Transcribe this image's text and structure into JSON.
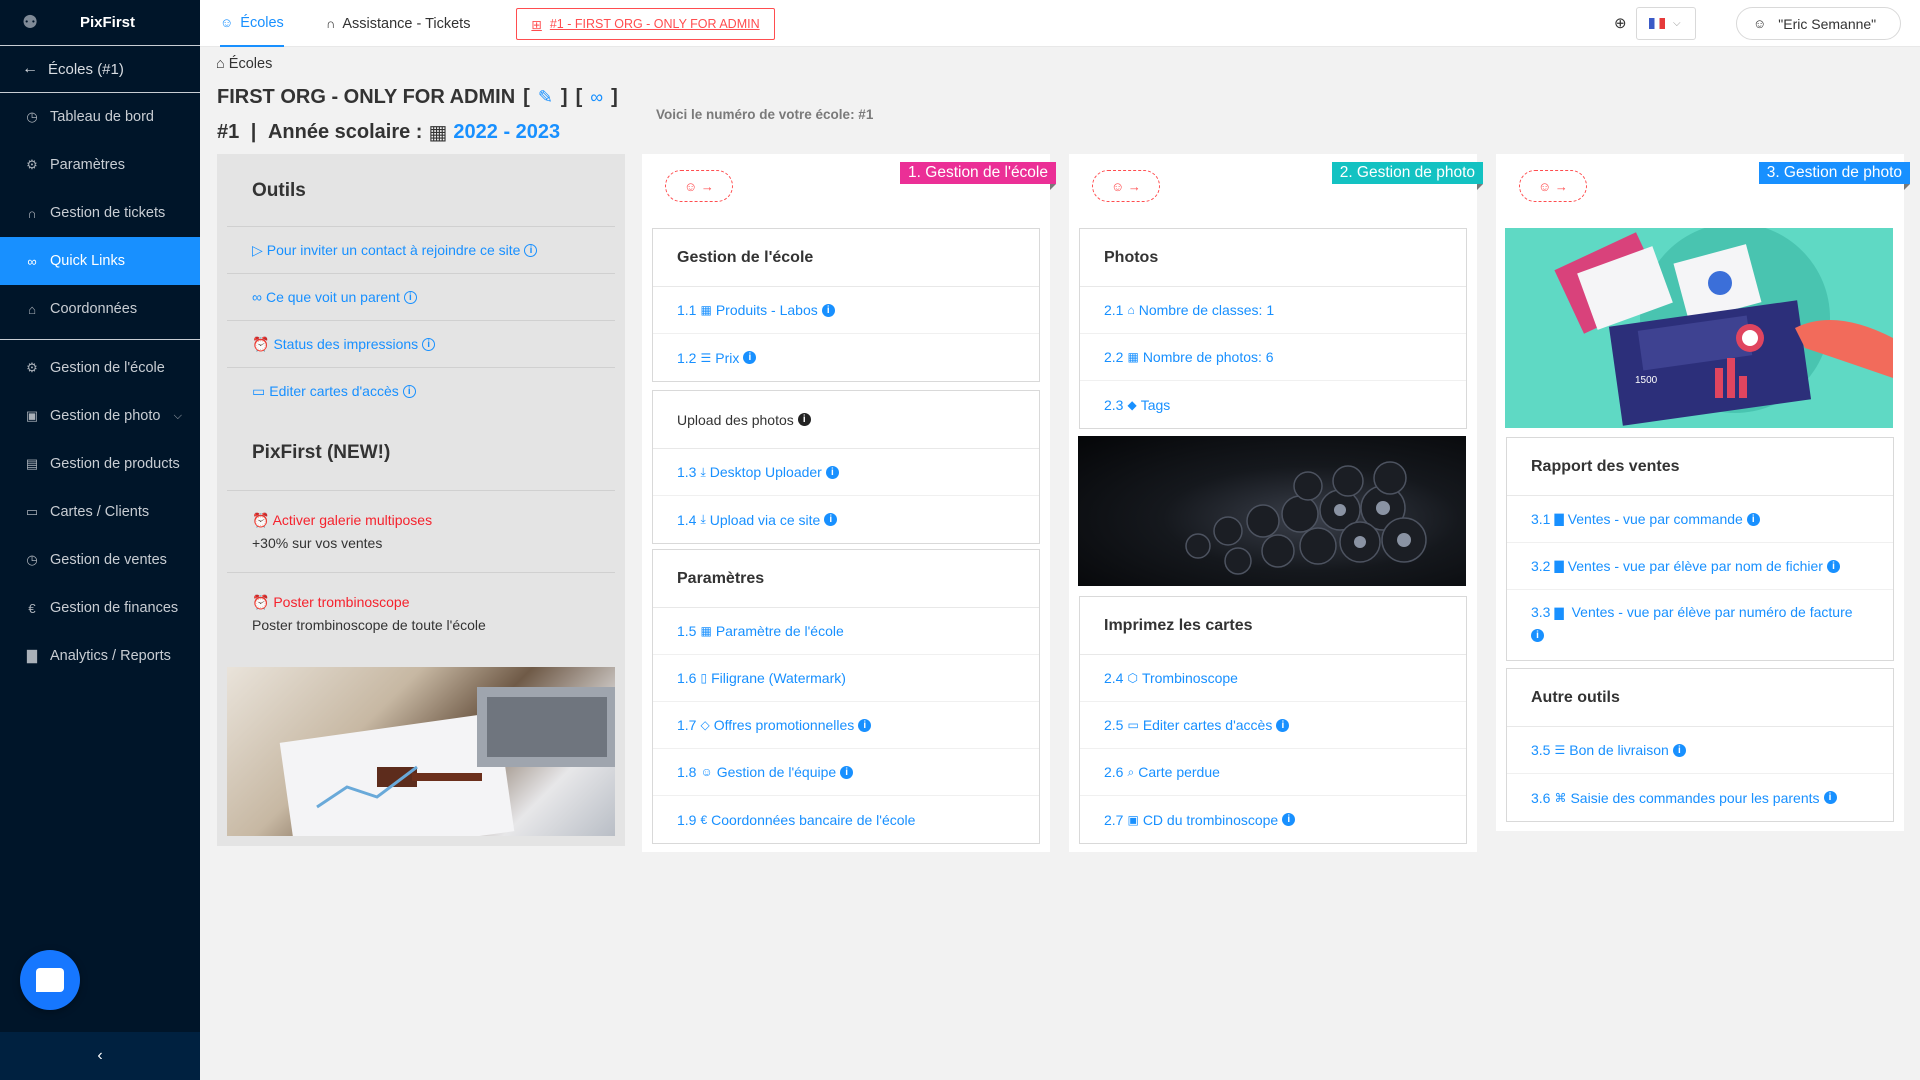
{
  "app": {
    "name": "PixFirst"
  },
  "sidebar": {
    "back_label": "Écoles (#1)",
    "items": [
      {
        "label": "Tableau de bord",
        "icon": "dashboard-icon"
      },
      {
        "label": "Paramètres",
        "icon": "gear-icon"
      },
      {
        "label": "Gestion de tickets",
        "icon": "headset-icon"
      },
      {
        "label": "Quick Links",
        "icon": "link-icon",
        "active": true
      },
      {
        "label": "Coordonnées",
        "icon": "bank-icon"
      },
      {
        "label": "Gestion de l'école",
        "icon": "gear-icon"
      },
      {
        "label": "Gestion de photo",
        "icon": "picture-icon"
      },
      {
        "label": "Gestion de products",
        "icon": "gift-icon"
      },
      {
        "label": "Cartes / Clients",
        "icon": "id-card-icon"
      },
      {
        "label": "Gestion de ventes",
        "icon": "dashboard-icon"
      },
      {
        "label": "Gestion de finances",
        "icon": "euro-icon"
      },
      {
        "label": "Analytics / Reports",
        "icon": "bar-chart-icon"
      }
    ]
  },
  "topbar": {
    "tabs": [
      {
        "label": "Écoles"
      },
      {
        "label": "Assistance - Tickets"
      }
    ],
    "org_badge": "#1 - FIRST ORG - ONLY FOR ADMIN",
    "user_name": "\"Eric Semanne\""
  },
  "page": {
    "breadcrumb": "Écoles",
    "title": "FIRST ORG - ONLY FOR ADMIN",
    "school_number_text": "Voici le numéro de votre école: #1",
    "id_label": "#1",
    "year_label": "Année scolaire :",
    "year_value": "2022 - 2023"
  },
  "outils": {
    "title": "Outils",
    "links": [
      "Pour inviter un contact à rejoindre ce site",
      "Ce que voit un parent",
      "Status des impressions",
      "Editer cartes d'accès"
    ],
    "new_title": "PixFirst (NEW!)",
    "promos": [
      {
        "title": "Activer galerie multiposes",
        "desc": "+30% sur vos ventes"
      },
      {
        "title": "Poster trombinoscope",
        "desc": "Poster trombinoscope de toute l'école"
      }
    ]
  },
  "col1": {
    "ribbon": "1. Gestion de l'école",
    "card1": {
      "title": "Gestion de l'école",
      "rows": [
        {
          "num": "1.1",
          "label": "Produits - Labos"
        },
        {
          "num": "1.2",
          "label": "Prix"
        }
      ]
    },
    "card2": {
      "title": "Upload des photos",
      "rows": [
        {
          "num": "1.3",
          "label": "Desktop Uploader"
        },
        {
          "num": "1.4",
          "label": "Upload via ce site"
        }
      ]
    },
    "card3": {
      "title": "Paramètres",
      "rows": [
        {
          "num": "1.5",
          "label": "Paramètre de l'école"
        },
        {
          "num": "1.6",
          "label": "Filigrane (Watermark)"
        },
        {
          "num": "1.7",
          "label": "Offres promotionnelles"
        },
        {
          "num": "1.8",
          "label": "Gestion de l'équipe"
        },
        {
          "num": "1.9",
          "label": "Coordonnées bancaire de l'école"
        }
      ]
    }
  },
  "col2": {
    "ribbon": "2. Gestion de photo",
    "card1": {
      "title": "Photos",
      "rows": [
        {
          "num": "2.1",
          "label": "Nombre de classes: 1"
        },
        {
          "num": "2.2",
          "label": "Nombre de photos: 6"
        },
        {
          "num": "2.3",
          "label": "Tags"
        }
      ]
    },
    "card2": {
      "title": "Imprimez les cartes",
      "rows": [
        {
          "num": "2.4",
          "label": "Trombinoscope"
        },
        {
          "num": "2.5",
          "label": "Editer cartes d'accès"
        },
        {
          "num": "2.6",
          "label": "Carte perdue"
        },
        {
          "num": "2.7",
          "label": "CD du trombinoscope"
        }
      ]
    }
  },
  "col3": {
    "ribbon": "3. Gestion de photo",
    "card1": {
      "title": "Rapport des ventes",
      "rows": [
        {
          "num": "3.1",
          "label": "Ventes - vue par commande"
        },
        {
          "num": "3.2",
          "label": "Ventes - vue par élève par nom de fichier"
        },
        {
          "num": "3.3",
          "label": "Ventes - vue par élève par numéro de facture"
        }
      ]
    },
    "card2": {
      "title": "Autre outils",
      "rows": [
        {
          "num": "3.5",
          "label": "Bon de livraison"
        },
        {
          "num": "3.6",
          "label": "Saisie des commandes pour les parents"
        }
      ]
    },
    "image_text": "1500"
  },
  "colors": {
    "accent": "#1890ff",
    "sidebar_bg": "#001529",
    "danger": "#ff4d4f",
    "ribbon1": "#eb2f96",
    "ribbon2": "#13c2c2",
    "ribbon3": "#1890ff"
  }
}
